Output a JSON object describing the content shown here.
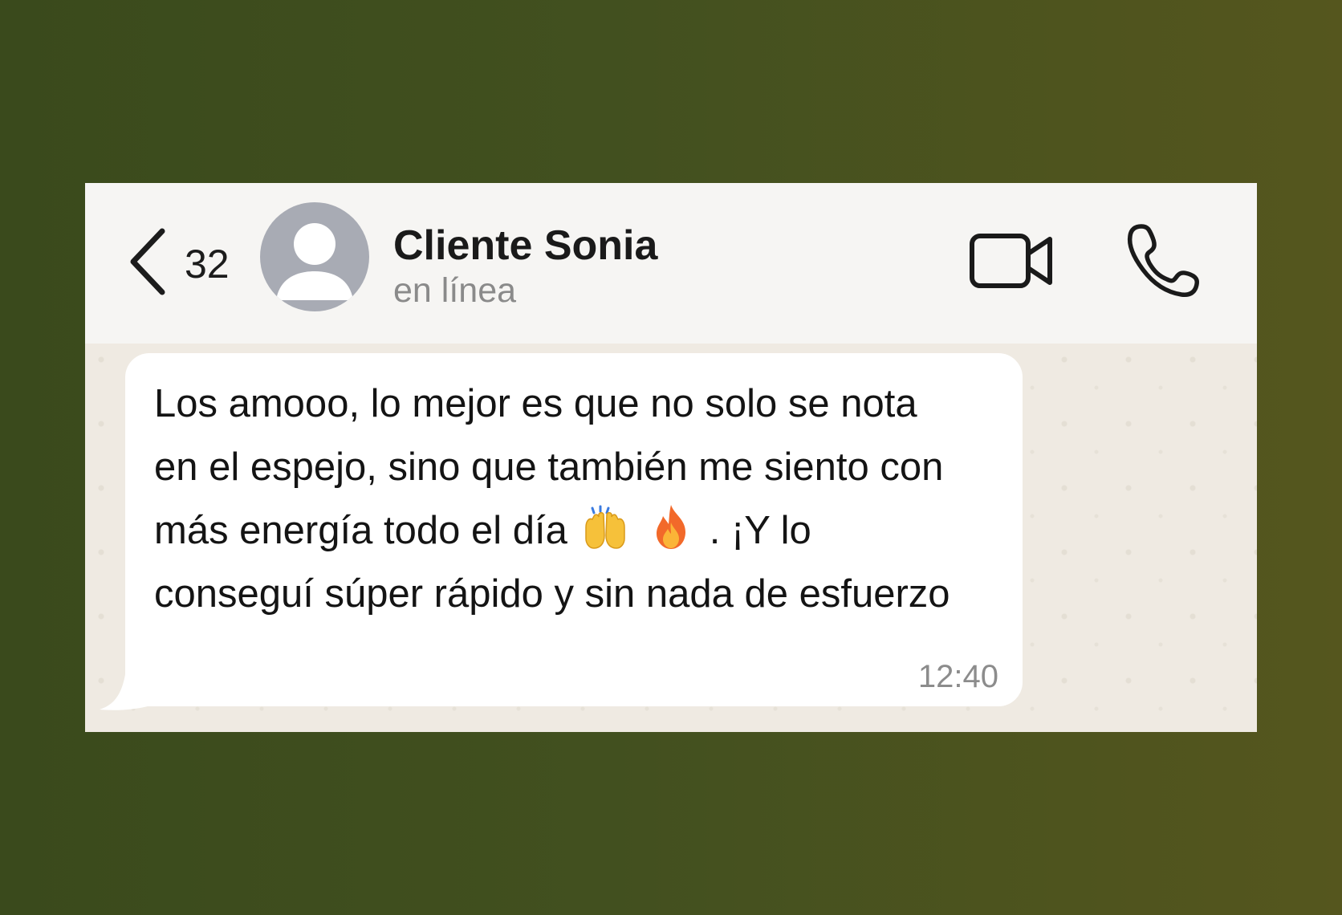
{
  "header": {
    "back_count": "32",
    "contact_name": "Cliente Sonia",
    "contact_status": "en línea"
  },
  "message": {
    "text_part1": "Los amooo, lo mejor es que no solo se nota en el espejo, sino que también me siento con más energía todo el día",
    "text_part2": ". ¡Y lo conseguí súper rápido y sin nada de esfuerzo",
    "emoji_1": "raising-hands-icon",
    "emoji_2": "fire-icon",
    "time": "12:40"
  }
}
